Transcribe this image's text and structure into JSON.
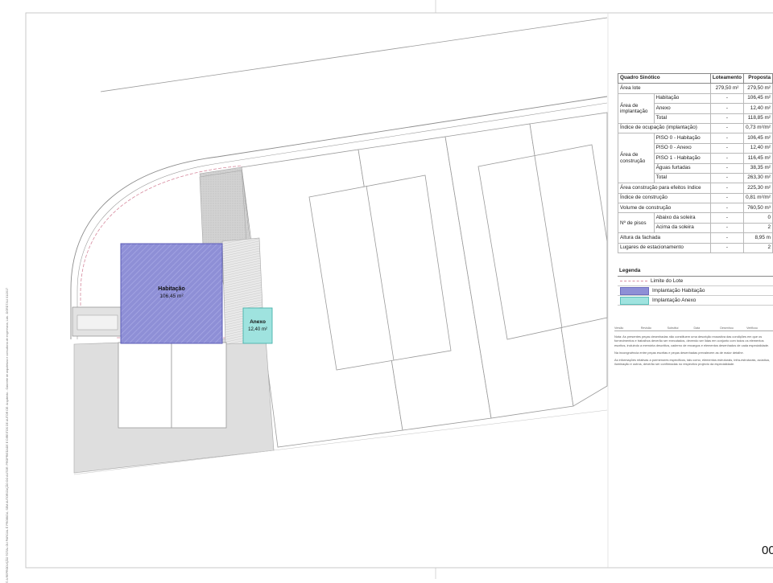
{
  "plan": {
    "habitacao_label": "Habitação",
    "habitacao_area": "106,45 m²",
    "anexo_label": "Anexo",
    "anexo_area": "12,40 m²"
  },
  "quadro": {
    "title": "Quadro Sinótico",
    "col_loteamento": "Loteamento",
    "col_proposta": "Proposta",
    "area_lote": {
      "label": "Área lote",
      "lot": "279,50 m²",
      "prop": "279,50 m²"
    },
    "implantacao": {
      "label": "Área de implantação",
      "rows": [
        {
          "name": "Habitação",
          "lot": "-",
          "prop": "106,45 m²"
        },
        {
          "name": "Anexo",
          "lot": "-",
          "prop": "12,40 m²"
        },
        {
          "name": "Total",
          "lot": "-",
          "prop": "118,85 m²"
        }
      ]
    },
    "indice_ocupacao": {
      "label": "Índice de ocupação (implantação)",
      "lot": "-",
      "prop": "0,73 m²/m²"
    },
    "construcao": {
      "label": "Área de construção",
      "rows": [
        {
          "name": "PISO 0 - Habitação",
          "lot": "-",
          "prop": "106,45 m²"
        },
        {
          "name": "PISO 0 - Anexo",
          "lot": "-",
          "prop": "12,40 m²"
        },
        {
          "name": "PISO 1 - Habitação",
          "lot": "-",
          "prop": "116,45 m²"
        },
        {
          "name": "Águas furtadas",
          "lot": "-",
          "prop": "38,35 m²"
        },
        {
          "name": "Total",
          "lot": "-",
          "prop": "263,30 m²"
        }
      ]
    },
    "area_efeitos": {
      "label": "Área construção para efeitos índice",
      "lot": "-",
      "prop": "225,30 m²"
    },
    "indice_construcao": {
      "label": "Índice de construção",
      "lot": "-",
      "prop": "0,81 m²/m²"
    },
    "volume": {
      "label": "Volume de construção",
      "lot": "-",
      "prop": "760,50 m³"
    },
    "pisos": {
      "label": "Nº de pisos",
      "rows": [
        {
          "name": "Abaixo da soleira",
          "lot": "-",
          "prop": "0"
        },
        {
          "name": "Acima da soleira",
          "lot": "-",
          "prop": "2"
        }
      ]
    },
    "altura": {
      "label": "Altura da fachada",
      "lot": "-",
      "prop": "8,95 m"
    },
    "lugares": {
      "label": "Lugares de estacionamento",
      "lot": "-",
      "prop": "2"
    }
  },
  "legenda": {
    "title": "Legenda",
    "items": [
      "Limite do Lote",
      "Implantação Habitação",
      "Implantação Anexo"
    ]
  },
  "revision": [
    "Versão",
    "Revisão",
    "Substitui",
    "Data",
    "Desenhou",
    "Verificou"
  ],
  "notes": [
    "Nota: As presentes peças desenhadas não constituem uma descrição exaustiva das condições em que os fornecimentos e trabalhos deverão ser executados, devendo ser lidas em conjunto com todos os elementos escritos, incluindo a memória descritiva, caderno de encargos e elementos desenhados de cada especialidade.",
    "Na incongruência entre peças escritas e peças desenhadas prevalecem as de maior detalhe.",
    "As informações relativas a pormenores específicos, tais como, elementos estruturais, infra-estruturais, acústica, iluminação e outros, deverão ser confirmadas no respectivo projecto da especialidade."
  ],
  "sheet_number": "00",
  "side_note": "© A REPRODUÇÃO TOTAL OU PARCIAL É PROIBIDA, SEM AUTORIZAÇÃO DO AUTOR. PROPRIEDADE E DIREITOS DE AUTOR DE: Arquitecto - Gabinete de arquitetura e consultoria de engenharia, Lda - DGRDT/LU 01/2017",
  "colors": {
    "habitacao": "#8e8fd6",
    "anexo": "#9fe3df",
    "lot_limit": "#d68a9e",
    "paving": "#cfcfcf"
  }
}
